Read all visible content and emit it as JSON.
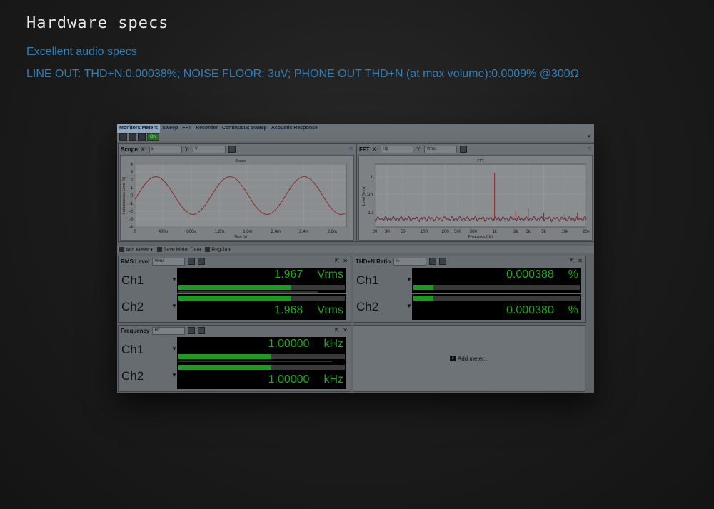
{
  "header": {
    "title": "Hardware specs",
    "subtitle": "Excellent audio specs",
    "specs": "LINE OUT: THD+N:0.00038%; NOISE FLOOR: 3uV; PHONE OUT THD+N (at max volume):0.0009% @300Ω"
  },
  "app": {
    "tabs": [
      "Monitors/Meters",
      "Sweep",
      "FFT",
      "Recorder",
      "Continuous Sweep",
      "Acoustic Response"
    ],
    "on_label": "ON",
    "scope": {
      "title": "Scope",
      "x_label": "X:",
      "x_unit": "s",
      "y_label": "Y:",
      "y_unit": "V",
      "chart_title": "Scope",
      "x_axis_label": "Time (s)",
      "y_axis_label": "Instantaneous Level (V)",
      "x_ticks": [
        "0",
        "400u",
        "800u",
        "1.2m",
        "1.6m",
        "2.0m",
        "2.4m",
        "2.8m"
      ],
      "y_ticks": [
        "4",
        "3",
        "2",
        "1",
        "0",
        "-1",
        "-2",
        "-3",
        "-4"
      ],
      "wave_color": "#8a2a2a"
    },
    "fft": {
      "title": "FFT",
      "x_label": "X:",
      "x_unit": "Hz",
      "y_label": "Y:",
      "y_unit": "Vrms",
      "chart_title": "FFT",
      "x_axis_label": "Frequency (Hz)",
      "y_axis_label": "Level (Vrms)",
      "x_ticks": [
        "20",
        "30",
        "50",
        "100",
        "200",
        "300",
        "500",
        "1k",
        "2k",
        "3k",
        "5k",
        "10k",
        "20k"
      ],
      "y_ticks": [
        "1",
        "1m",
        "1u"
      ]
    },
    "meter_toolbar": {
      "add": "Add Meter",
      "save": "Save Meter Data",
      "regulate": "Regulate"
    },
    "rms": {
      "title": "RMS Level",
      "unit_select": "Vrms",
      "channels": [
        {
          "label": "Ch1",
          "value": "1.967",
          "unit": "Vrms",
          "level": 0.68
        },
        {
          "label": "Ch2",
          "value": "1.968",
          "unit": "Vrms",
          "level": 0.68
        }
      ]
    },
    "thd": {
      "title": "THD+N Ratio",
      "unit_select": "%",
      "channels": [
        {
          "label": "Ch1",
          "value": "0.000388",
          "unit": "%",
          "level": 0.12
        },
        {
          "label": "Ch2",
          "value": "0.000380",
          "unit": "%",
          "level": 0.12
        }
      ]
    },
    "freq": {
      "title": "Frequency",
      "unit_select": "Hz",
      "channels": [
        {
          "label": "Ch1",
          "value": "1.00000",
          "unit": "kHz",
          "level": 0.56
        },
        {
          "label": "Ch2",
          "value": "1.00000",
          "unit": "kHz",
          "level": 0.56
        }
      ]
    },
    "add_meter": "Add meter..."
  }
}
